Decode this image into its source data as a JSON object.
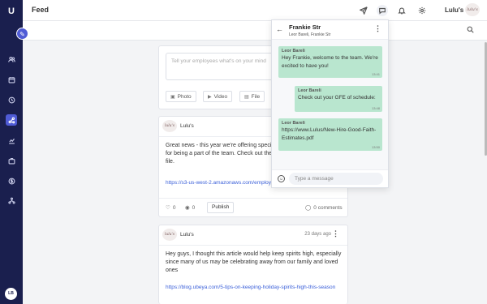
{
  "app": {
    "logo": "U",
    "page_title": "Feed",
    "user_name": "Lulu's",
    "user_initials": "LB",
    "brand_logo": "lulu's"
  },
  "sidebar": {
    "compose_icon": "pencil-icon",
    "items": [
      {
        "name": "people",
        "icon": "users-icon"
      },
      {
        "name": "calendar",
        "icon": "calendar-icon"
      },
      {
        "name": "time",
        "icon": "clock-icon"
      },
      {
        "name": "feed",
        "icon": "feed-icon",
        "active": true
      },
      {
        "name": "reports",
        "icon": "chart-icon"
      },
      {
        "name": "benefits",
        "icon": "briefcase-icon"
      },
      {
        "name": "payroll",
        "icon": "dollar-icon"
      },
      {
        "name": "org",
        "icon": "org-chart-icon"
      }
    ]
  },
  "composer": {
    "placeholder": "Tell your employees what's on your mind",
    "photo": "Photo",
    "video": "Video",
    "file": "File"
  },
  "posts": [
    {
      "author": "Lulu's",
      "date": "",
      "body": "Great news - this year we're offering special discounts as a thank you for being a part of the team. Check out the discounts in the attached file.",
      "link": "https://s3-us-west-2.amazonaws.com/employee",
      "likes": "0",
      "views": "0",
      "publish": "Publish",
      "comments": "0 comments"
    },
    {
      "author": "Lulu's",
      "date": "23 days ago",
      "body": "Hey guys, I thought this article would help keep spirits high, especially since many of us may be celebrating away from our family and loved ones",
      "link": "https://blog.ubeya.com/5-tips-on-keeping-holiday-spirits-high-this-season"
    }
  ],
  "chat": {
    "title": "Frankie Str",
    "participants": "Leor Bareli, Frankie Str",
    "messages": [
      {
        "sender": "Leor Bareli",
        "text": "Hey Frankie, welcome to the team. We're excited to have you!",
        "time": "13:41"
      },
      {
        "sender": "Leor Bareli",
        "text": "Check out your GFE of schedule:",
        "time": "13:48"
      },
      {
        "sender": "Leor Bareli",
        "text": "https://www.Lulus/New-Hire-Good-Faith-Estimates.pdf",
        "time": "13:50"
      }
    ],
    "input_placeholder": "Type a message"
  }
}
